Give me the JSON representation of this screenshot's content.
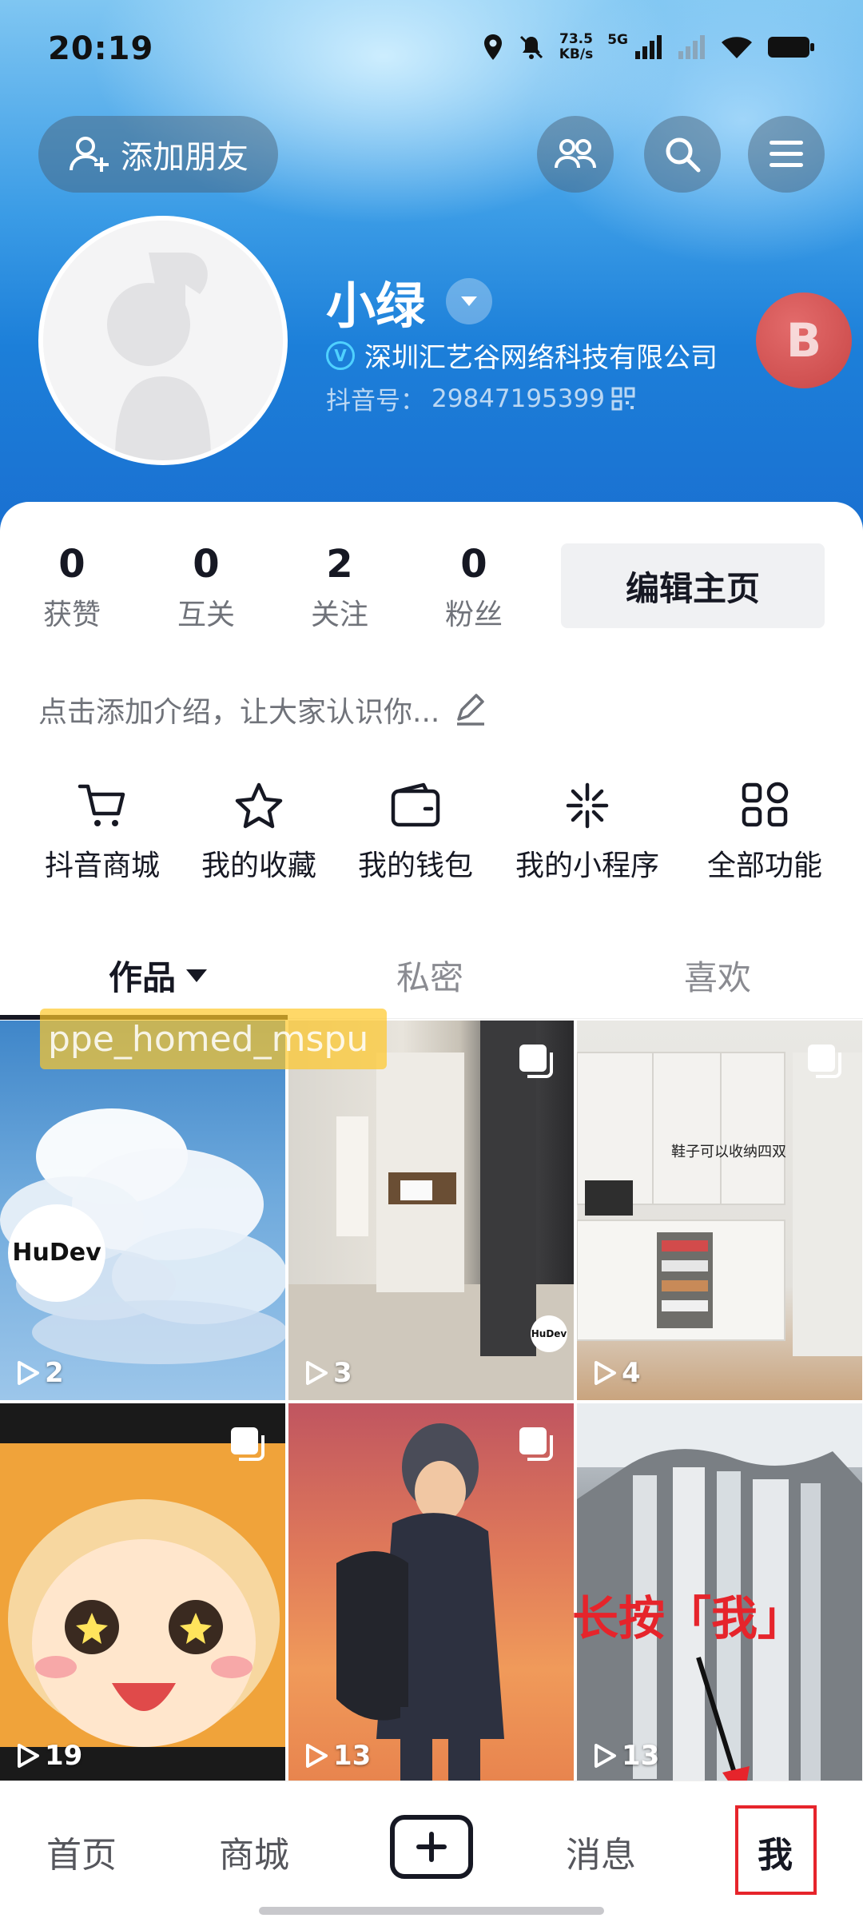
{
  "status_bar": {
    "time": "20:19",
    "net_speed_value": "73.5",
    "net_speed_unit": "KB/s",
    "network": "5G"
  },
  "header": {
    "add_friend_label": "添加朋友"
  },
  "profile": {
    "name": "小绿",
    "company": "深圳汇艺谷网络科技有限公司",
    "douyin_id_label": "抖音号：",
    "douyin_id": "29847195399",
    "floating_badge": "B"
  },
  "stats": [
    {
      "value": "0",
      "label": "获赞"
    },
    {
      "value": "0",
      "label": "互关"
    },
    {
      "value": "2",
      "label": "关注"
    },
    {
      "value": "0",
      "label": "粉丝"
    }
  ],
  "edit_profile_label": "编辑主页",
  "intro_placeholder": "点击添加介绍，让大家认识你...",
  "features": [
    {
      "label": "抖音商城",
      "icon": "cart-icon"
    },
    {
      "label": "我的收藏",
      "icon": "star-icon"
    },
    {
      "label": "我的钱包",
      "icon": "wallet-icon"
    },
    {
      "label": "我的小程序",
      "icon": "mini-program-icon"
    },
    {
      "label": "全部功能",
      "icon": "grid-apps-icon"
    }
  ],
  "tabs": [
    {
      "label": "作品",
      "active": true
    },
    {
      "label": "私密",
      "active": false
    },
    {
      "label": "喜欢",
      "active": false
    }
  ],
  "watermark": "ppe_homed_mspu",
  "videos": [
    {
      "plays": "2",
      "scene": "sky-clouds"
    },
    {
      "plays": "3",
      "scene": "home-interior"
    },
    {
      "plays": "4",
      "scene": "shoe-cabinet"
    },
    {
      "plays": "19",
      "scene": "anime-girl"
    },
    {
      "plays": "13",
      "scene": "anime-boy-sunset"
    },
    {
      "plays": "13",
      "scene": "waterfall"
    }
  ],
  "hudev_logo": "HuDev",
  "shoe_caption": "鞋子可以收纳四双",
  "annotation": "长按「我」",
  "bottom_nav": {
    "home": "首页",
    "mall": "商城",
    "messages": "消息",
    "me": "我"
  },
  "colors": {
    "accent_red": "#e6242b",
    "hero_blue": "#1c7fd9",
    "text_primary": "#161823",
    "text_secondary": "#70737a"
  }
}
